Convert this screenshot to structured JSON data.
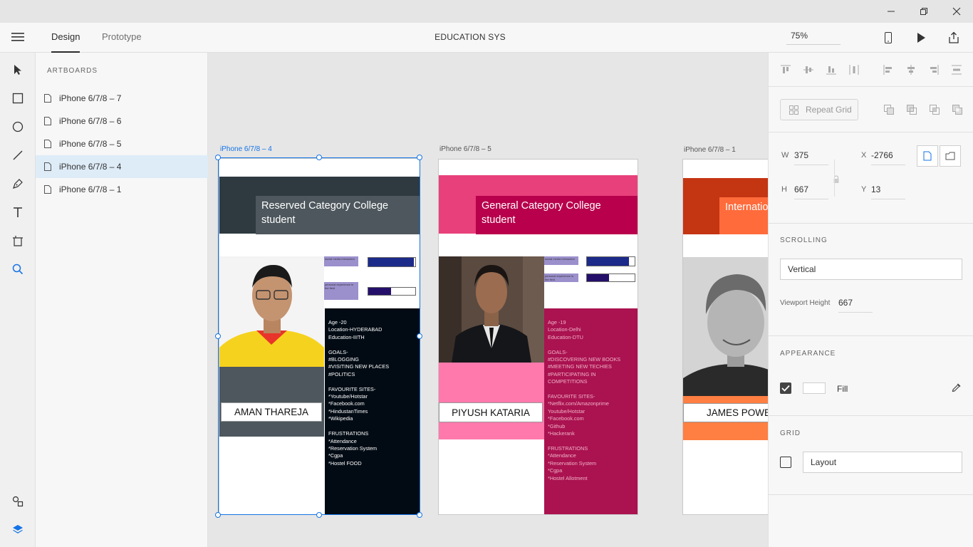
{
  "window": {
    "minimize_icon": "minimize-icon",
    "restore_icon": "restore-icon",
    "close_icon": "close-icon"
  },
  "toolbar": {
    "tabs": [
      {
        "label": "Design",
        "active": true
      },
      {
        "label": "Prototype",
        "active": false
      }
    ],
    "document_title": "EDUCATION SYS",
    "zoom": "75%"
  },
  "layers": {
    "heading": "ARTBOARDS",
    "items": [
      {
        "label": "iPhone 6/7/8 – 7",
        "selected": false
      },
      {
        "label": "iPhone 6/7/8 – 6",
        "selected": false
      },
      {
        "label": "iPhone 6/7/8 – 5",
        "selected": false
      },
      {
        "label": "iPhone 6/7/8 – 4",
        "selected": true
      },
      {
        "label": "iPhone 6/7/8 – 1",
        "selected": false
      }
    ]
  },
  "artboards": [
    {
      "label": "iPhone 6/7/8 – 4",
      "title": "Reserved  Category College student",
      "name": "AMAN THAREJA",
      "bio": "Age -20\nLocation-HYDERABAD\nEducation-IIITH\n\nGOALS-\n#BLOGGING\n#VISITING NEW PLACES\n#POLITICS\n\nFAVOURITE SITES-\n*Youtube/Hotstar\n*Facebook.com\n*HindustanTimes\n*Wikipedia\n\nFRUSTRATIONS\n*Attendance\n*Reservation System\n*Cgpa\n*Hostel FOOD",
      "skill_labels": [
        "social media interaction",
        "personal experience in the field"
      ],
      "skill_levels": [
        0.97,
        0.48
      ],
      "colors": {
        "header": "#2e3a40",
        "title_box": "#4d575d",
        "band": "#4d575d",
        "bio_bg": "#020b14",
        "bio_text": "#ffffff",
        "bar1": "#1c2a8a",
        "bar2": "#24106a",
        "label_bg": "#9b8fcc"
      }
    },
    {
      "label": "iPhone 6/7/8 – 5",
      "title": "General Category College student",
      "name": "PIYUSH KATARIA",
      "bio": "Age -19\nLocation-Delhi\nEducation-DTU\n\nGOALS-\n#DISCOVERING NEW BOOKS\n#MEETING NEW TECHIES\n#PARTICIPATING IN COMPETITIONS\n\nFAVOURITE SITES-\n*Netflix.com/Amazonprime\nYoutube/Hotstar\n*Facebook.com\n*Github\n*Hackerank\n\nFRUSTRATIONS\n*Attendance\n*Reservation System\n*Cgpa\n*Hostel Allotment",
      "skill_labels": [
        "social media interaction",
        "personal experience in the field"
      ],
      "skill_levels": [
        0.88,
        0.46
      ],
      "colors": {
        "header": "#e8407a",
        "title_box": "#b8004c",
        "band": "#ff79ac",
        "bio_bg": "#aa1250",
        "bio_text": "#f0b3c8",
        "bar1": "#1c2a8a",
        "bar2": "#24106a",
        "label_bg": "#9b8fcc"
      }
    },
    {
      "label": "iPhone 6/7/8 – 1",
      "title": "Internatio",
      "name": "JAMES POWE",
      "colors": {
        "header": "#c43512",
        "title_box": "#ff6b3b",
        "band": "#ff7e42"
      }
    }
  ],
  "inspector": {
    "repeat_grid_label": "Repeat Grid",
    "w_label": "W",
    "w_value": "375",
    "h_label": "H",
    "h_value": "667",
    "x_label": "X",
    "x_value": "-2766",
    "y_label": "Y",
    "y_value": "13",
    "scrolling_title": "SCROLLING",
    "scrolling_value": "Vertical",
    "viewport_label": "Viewport Height",
    "viewport_value": "667",
    "appearance_title": "APPEARANCE",
    "fill_label": "Fill",
    "fill_checked": true,
    "fill_color": "#ffffff",
    "grid_title": "GRID",
    "grid_value": "Layout",
    "grid_checked": false
  }
}
